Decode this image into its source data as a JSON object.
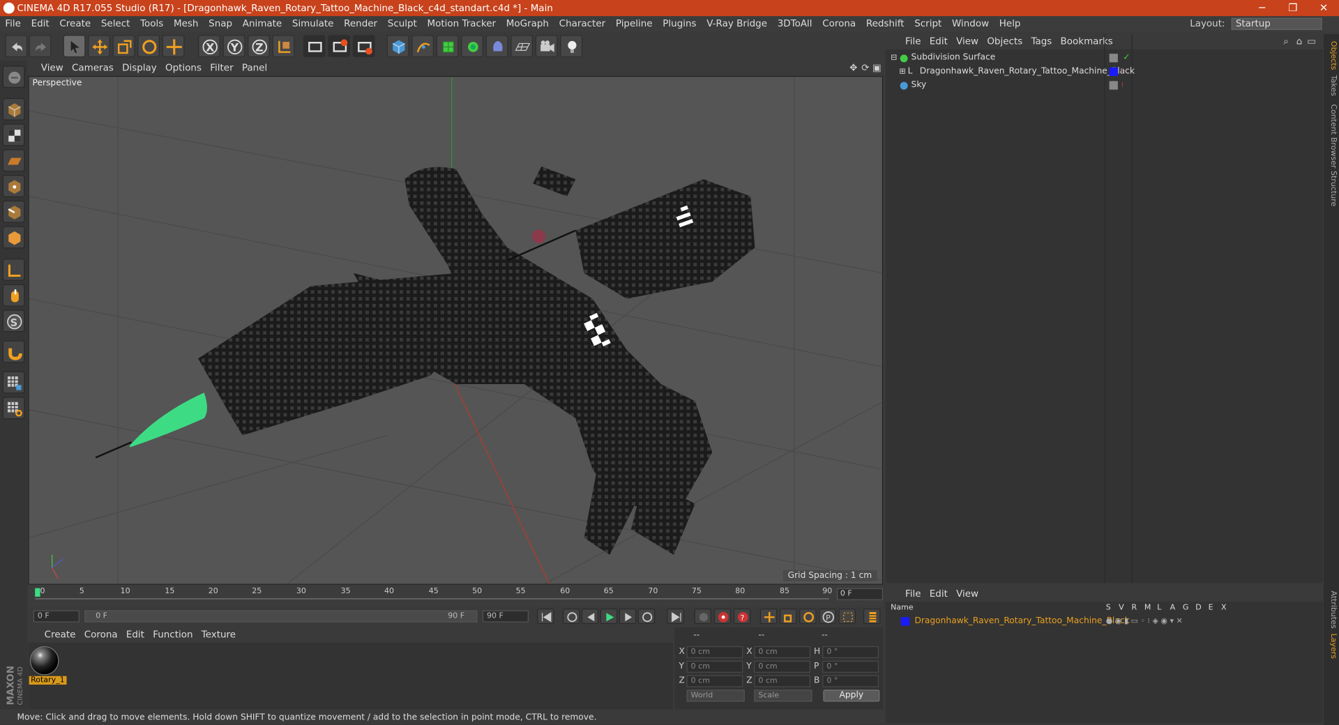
{
  "titlebar": {
    "title": "CINEMA 4D R17.055 Studio (R17) - [Dragonhawk_Raven_Rotary_Tattoo_Machine_Black_c4d_standart.c4d *] - Main"
  },
  "menubar": {
    "items": [
      "File",
      "Edit",
      "Create",
      "Select",
      "Tools",
      "Mesh",
      "Snap",
      "Animate",
      "Simulate",
      "Render",
      "Sculpt",
      "Motion Tracker",
      "MoGraph",
      "Character",
      "Pipeline",
      "Plugins",
      "V-Ray Bridge",
      "3DToAll",
      "Corona",
      "Redshift",
      "Script",
      "Window",
      "Help"
    ]
  },
  "layout": {
    "label": "Layout:",
    "value": "Startup"
  },
  "viewport": {
    "menu": [
      "View",
      "Cameras",
      "Display",
      "Options",
      "Filter",
      "Panel"
    ],
    "label": "Perspective",
    "grid_spacing": "Grid Spacing : 1 cm"
  },
  "timeline": {
    "ticks": [
      "0",
      "5",
      "10",
      "15",
      "20",
      "25",
      "30",
      "35",
      "40",
      "45",
      "50",
      "55",
      "60",
      "65",
      "70",
      "75",
      "80",
      "85",
      "90"
    ],
    "current_frame": "0 F",
    "start": "0 F",
    "range_start": "0 F",
    "range_end": "90 F",
    "end": "90 F"
  },
  "material_manager": {
    "menu": [
      "Create",
      "Corona",
      "Edit",
      "Function",
      "Texture"
    ],
    "material_name": "Rotary_1"
  },
  "coordinates": {
    "headers": [
      "--",
      "--",
      "--"
    ],
    "rows": [
      {
        "l1": "X",
        "v1": "0 cm",
        "l2": "X",
        "v2": "0 cm",
        "l3": "H",
        "v3": "0 °"
      },
      {
        "l1": "Y",
        "v1": "0 cm",
        "l2": "Y",
        "v2": "0 cm",
        "l3": "P",
        "v3": "0 °"
      },
      {
        "l1": "Z",
        "v1": "0 cm",
        "l2": "Z",
        "v2": "0 cm",
        "l3": "B",
        "v3": "0 °"
      }
    ],
    "mode": "World",
    "type": "Scale",
    "apply": "Apply"
  },
  "object_manager": {
    "menu": [
      "File",
      "Edit",
      "View",
      "Objects",
      "Tags",
      "Bookmarks"
    ],
    "objects": [
      {
        "name": "Subdivision Surface"
      },
      {
        "name": "Dragonhawk_Raven_Rotary_Tattoo_Machine_Black"
      },
      {
        "name": "Sky"
      }
    ]
  },
  "layer_manager": {
    "menu": [
      "File",
      "Edit",
      "View"
    ],
    "columns": [
      "Name",
      "S",
      "V",
      "R",
      "M",
      "L",
      "A",
      "G",
      "D",
      "E",
      "X"
    ],
    "layer_name": "Dragonhawk_Raven_Rotary_Tattoo_Machine_Black",
    "layer_color": "#1a1aff"
  },
  "right_tabs": [
    "Objects",
    "Takes",
    "Content Browser",
    "Structure",
    "Attributes",
    "Layers"
  ],
  "status": "Move: Click and drag to move elements. Hold down SHIFT to quantize movement / add to the selection in point mode, CTRL to remove.",
  "colors": {
    "titlebar": "#c8421b",
    "accent": "#e8a020",
    "green_tip": "#3ddc84"
  },
  "brand": [
    "MAXON",
    "CINEMA 4D"
  ]
}
